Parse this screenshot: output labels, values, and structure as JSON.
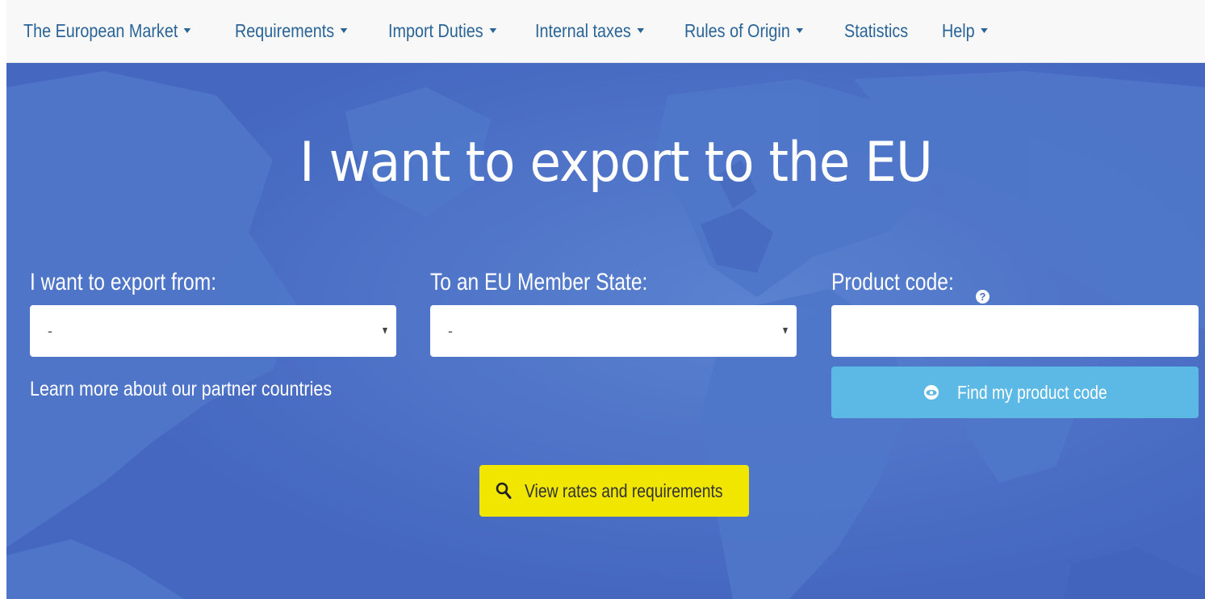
{
  "nav": {
    "items": [
      {
        "label": "The European Market",
        "has_dropdown": true
      },
      {
        "label": "Requirements",
        "has_dropdown": true
      },
      {
        "label": "Import Duties",
        "has_dropdown": true
      },
      {
        "label": "Internal taxes",
        "has_dropdown": true
      },
      {
        "label": "Rules of Origin",
        "has_dropdown": true
      },
      {
        "label": "Statistics",
        "has_dropdown": false
      },
      {
        "label": "Help",
        "has_dropdown": true
      }
    ]
  },
  "hero": {
    "title": "I want to export to the EU",
    "export_from": {
      "label": "I want to export from:",
      "value": "-"
    },
    "member_state": {
      "label": "To an EU Member State:",
      "value": "-"
    },
    "product_code": {
      "label": "Product code:",
      "value": "",
      "help_icon": "question-circle-icon"
    },
    "partner_link": "Learn more about our partner countries",
    "find_button": {
      "label": "Find my product code",
      "icon": "eye-icon"
    },
    "view_button": {
      "label": "View rates and requirements",
      "icon": "search-icon"
    }
  },
  "colors": {
    "nav_background": "#f8f8f8",
    "nav_link": "#2a6496",
    "hero_background": "#4a6fc6",
    "find_button": "#5cb8e4",
    "view_button": "#f1e600",
    "text_light": "#ffffff"
  }
}
